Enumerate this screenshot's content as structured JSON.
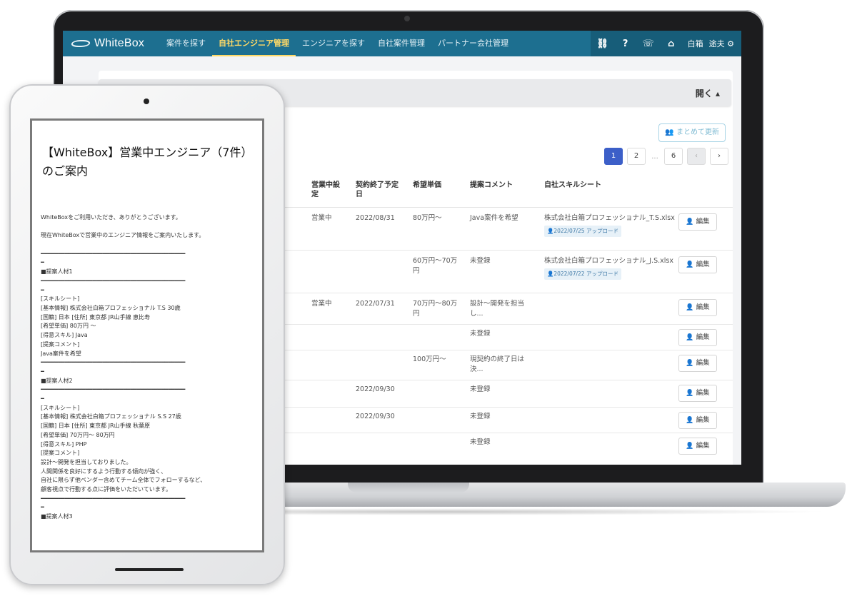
{
  "nav": {
    "brand": "WhiteBox",
    "items": [
      {
        "label": "案件を探す",
        "active": false
      },
      {
        "label": "自社エンジニア管理",
        "active": true
      },
      {
        "label": "エンジニアを探す",
        "active": false
      },
      {
        "label": "自社案件管理",
        "active": false
      },
      {
        "label": "パートナー会社管理",
        "active": false
      }
    ],
    "right_icons": [
      {
        "name": "handshake-icon",
        "glyph": "⛓"
      },
      {
        "name": "help-icon",
        "glyph": "?"
      },
      {
        "name": "chat-icon",
        "glyph": "☏"
      },
      {
        "name": "home-icon",
        "glyph": "⌂"
      }
    ],
    "user_last": "白箱",
    "user_first": "途夫",
    "settings_glyph": "⚙"
  },
  "filter": {
    "toggle_label": "開く ▴"
  },
  "toolbar": {
    "bulk_update_label": "👥 まとめて更新"
  },
  "pager": {
    "pages": [
      "1",
      "2",
      "...",
      "6"
    ],
    "prev": "‹",
    "next": "›"
  },
  "table": {
    "columns": [
      "営業中設定",
      "契約終了予定日",
      "希望単価",
      "提案コメント",
      "自社スキルシート"
    ],
    "edit_label": "編集",
    "edit_icon": "👤",
    "rows": [
      {
        "status": "営業中",
        "end_date": "2022/08/31",
        "price": "80万円〜",
        "comment": "Java案件を希望",
        "sheet": "株式会社白箱プロフェッショナル_T.S.xlsx",
        "upload": "👤2022/07/25 アップロード"
      },
      {
        "status": "",
        "end_date": "",
        "price": "60万円〜70万円",
        "comment": "未登録",
        "sheet": "株式会社白箱プロフェッショナル_J.S.xlsx",
        "upload": "👤2022/07/22 アップロード"
      },
      {
        "status": "営業中",
        "end_date": "2022/07/31",
        "price": "70万円〜80万円",
        "comment": "設計〜開発を担当し...",
        "sheet": "",
        "upload": ""
      },
      {
        "status": "",
        "end_date": "",
        "price": "",
        "comment": "未登録",
        "sheet": "",
        "upload": ""
      },
      {
        "status": "",
        "end_date": "",
        "price": "100万円〜",
        "comment": "現契約の終了日は決...",
        "sheet": "",
        "upload": ""
      },
      {
        "status": "",
        "end_date": "2022/09/30",
        "price": "",
        "comment": "未登録",
        "sheet": "",
        "upload": ""
      },
      {
        "status": "",
        "end_date": "2022/09/30",
        "price": "",
        "comment": "未登録",
        "sheet": "",
        "upload": ""
      },
      {
        "status": "",
        "end_date": "",
        "price": "",
        "comment": "未登録",
        "sheet": "",
        "upload": ""
      }
    ]
  },
  "mail": {
    "title": "【WhiteBox】営業中エンジニア（7件）のご案内",
    "lines": [
      "WhiteBoxをご利用いただき、ありがとうございます。",
      "",
      "現在WhiteBoxで営業中のエンジニア情報をご案内いたします。",
      "",
      "━━━━━━━━━━━━━━━━━━━━━━━━━━━━━━━━━━━━━━━━━━",
      "━",
      "■提案人材1",
      "━━━━━━━━━━━━━━━━━━━━━━━━━━━━━━━━━━━━━━━━━━",
      "━",
      "[スキルシート]",
      "[基本情報] 株式会社白箱プロフェッショナル T.S 30歳",
      "[国籍] 日本 [住所] 東京都 JR山手線 恵比寿",
      "[希望単価] 80万円 〜",
      "[得意スキル] Java",
      "[提案コメント]",
      "Java案件を希望",
      "━━━━━━━━━━━━━━━━━━━━━━━━━━━━━━━━━━━━━━━━━━",
      "━",
      "■提案人材2",
      "━━━━━━━━━━━━━━━━━━━━━━━━━━━━━━━━━━━━━━━━━━",
      "━",
      "[スキルシート]",
      "[基本情報] 株式会社白箱プロフェッショナル S.S 27歳",
      "[国籍] 日本 [住所] 東京都 JR山手線 秋葉原",
      "[希望単価] 70万円〜 80万円",
      "[得意スキル] PHP",
      "[提案コメント]",
      "設計〜開発を担当しておりました。",
      "人間関係を良好にするよう行動する傾向が強く、",
      "自社に限らず他ベンダー含めてチーム全体でフォローするなど、",
      "顧客視点で行動する点に評価をいただいています。",
      "━━━━━━━━━━━━━━━━━━━━━━━━━━━━━━━━━━━━━━━━━━",
      "━",
      "■提案人材3"
    ]
  }
}
